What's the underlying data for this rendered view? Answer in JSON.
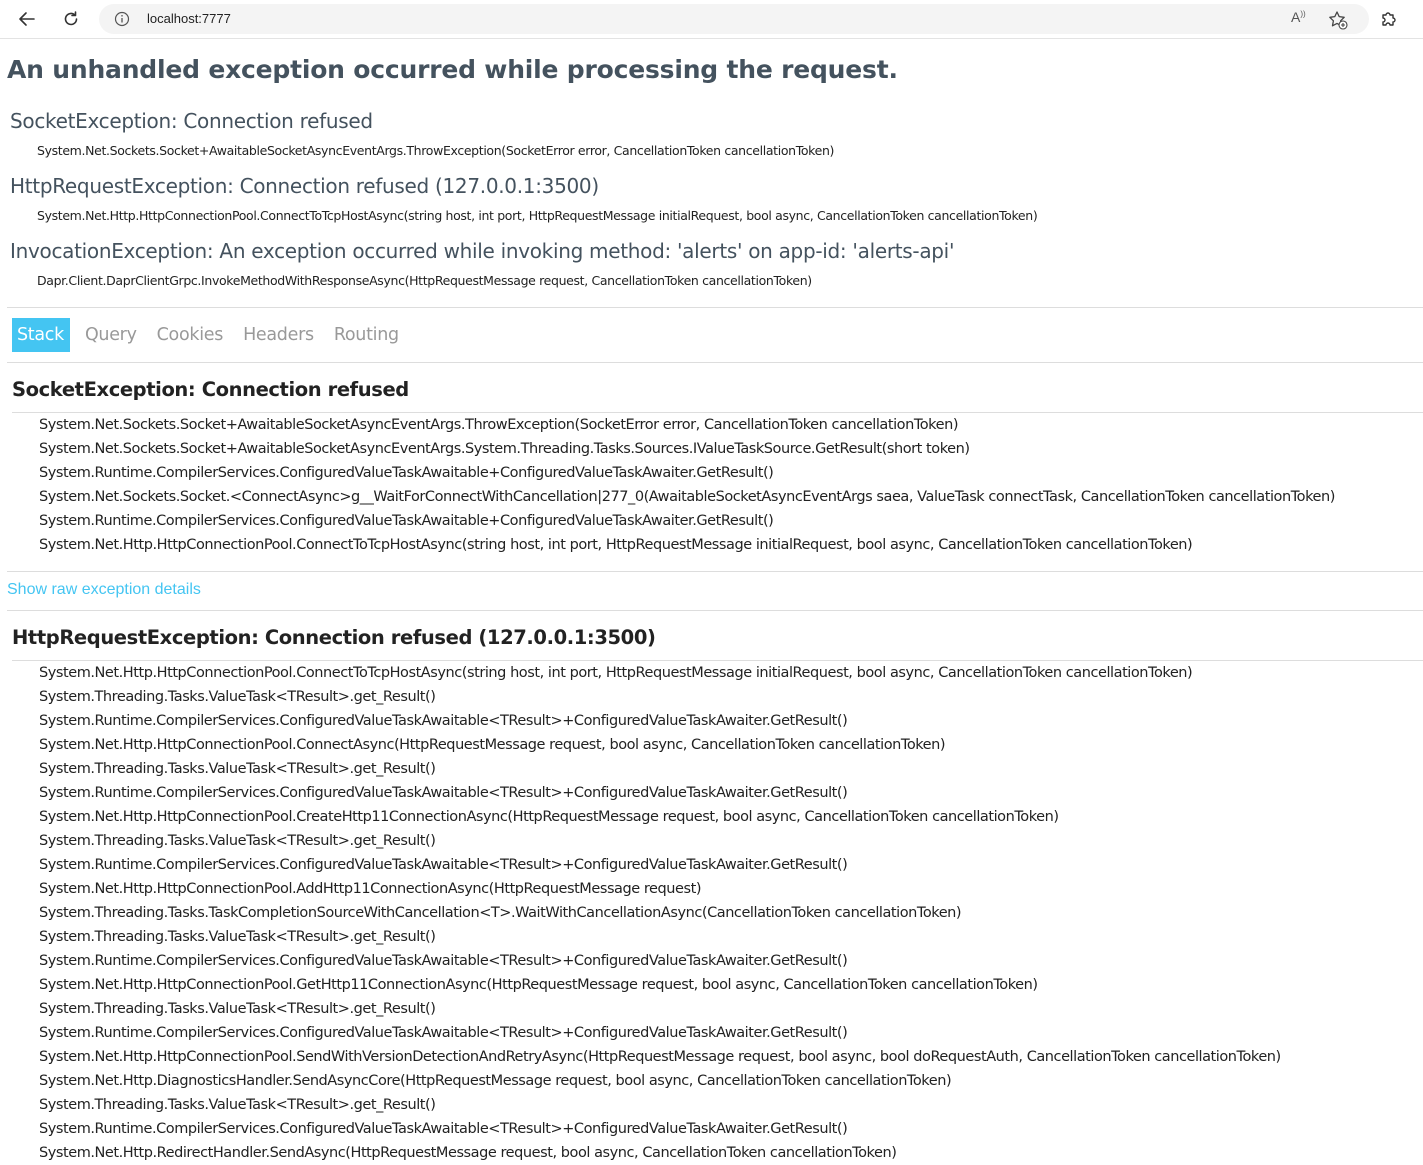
{
  "browser": {
    "url": "localhost:7777",
    "read_aloud_label": "A"
  },
  "page": {
    "title": "An unhandled exception occurred while processing the request.",
    "summary": [
      {
        "title": "SocketException: Connection refused",
        "location": "System.Net.Sockets.Socket+AwaitableSocketAsyncEventArgs.ThrowException(SocketError error, CancellationToken cancellationToken)"
      },
      {
        "title": "HttpRequestException: Connection refused (127.0.0.1:3500)",
        "location": "System.Net.Http.HttpConnectionPool.ConnectToTcpHostAsync(string host, int port, HttpRequestMessage initialRequest, bool async, CancellationToken cancellationToken)"
      },
      {
        "title": "InvocationException: An exception occurred while invoking method: 'alerts' on app-id: 'alerts-api'",
        "location": "Dapr.Client.DaprClientGrpc.InvokeMethodWithResponseAsync(HttpRequestMessage request, CancellationToken cancellationToken)"
      }
    ],
    "tabs": [
      "Stack",
      "Query",
      "Cookies",
      "Headers",
      "Routing"
    ],
    "active_tab": "Stack",
    "raw_link": "Show raw exception details",
    "stack_sections": [
      {
        "title": "SocketException: Connection refused",
        "frames": [
          "System.Net.Sockets.Socket+AwaitableSocketAsyncEventArgs.ThrowException(SocketError error, CancellationToken cancellationToken)",
          "System.Net.Sockets.Socket+AwaitableSocketAsyncEventArgs.System.Threading.Tasks.Sources.IValueTaskSource.GetResult(short token)",
          "System.Runtime.CompilerServices.ConfiguredValueTaskAwaitable+ConfiguredValueTaskAwaiter.GetResult()",
          "System.Net.Sockets.Socket.<ConnectAsync>g__WaitForConnectWithCancellation|277_0(AwaitableSocketAsyncEventArgs saea, ValueTask connectTask, CancellationToken cancellationToken)",
          "System.Runtime.CompilerServices.ConfiguredValueTaskAwaitable+ConfiguredValueTaskAwaiter.GetResult()",
          "System.Net.Http.HttpConnectionPool.ConnectToTcpHostAsync(string host, int port, HttpRequestMessage initialRequest, bool async, CancellationToken cancellationToken)"
        ]
      },
      {
        "title": "HttpRequestException: Connection refused (127.0.0.1:3500)",
        "frames": [
          "System.Net.Http.HttpConnectionPool.ConnectToTcpHostAsync(string host, int port, HttpRequestMessage initialRequest, bool async, CancellationToken cancellationToken)",
          "System.Threading.Tasks.ValueTask<TResult>.get_Result()",
          "System.Runtime.CompilerServices.ConfiguredValueTaskAwaitable<TResult>+ConfiguredValueTaskAwaiter.GetResult()",
          "System.Net.Http.HttpConnectionPool.ConnectAsync(HttpRequestMessage request, bool async, CancellationToken cancellationToken)",
          "System.Threading.Tasks.ValueTask<TResult>.get_Result()",
          "System.Runtime.CompilerServices.ConfiguredValueTaskAwaitable<TResult>+ConfiguredValueTaskAwaiter.GetResult()",
          "System.Net.Http.HttpConnectionPool.CreateHttp11ConnectionAsync(HttpRequestMessage request, bool async, CancellationToken cancellationToken)",
          "System.Threading.Tasks.ValueTask<TResult>.get_Result()",
          "System.Runtime.CompilerServices.ConfiguredValueTaskAwaitable<TResult>+ConfiguredValueTaskAwaiter.GetResult()",
          "System.Net.Http.HttpConnectionPool.AddHttp11ConnectionAsync(HttpRequestMessage request)",
          "System.Threading.Tasks.TaskCompletionSourceWithCancellation<T>.WaitWithCancellationAsync(CancellationToken cancellationToken)",
          "System.Threading.Tasks.ValueTask<TResult>.get_Result()",
          "System.Runtime.CompilerServices.ConfiguredValueTaskAwaitable<TResult>+ConfiguredValueTaskAwaiter.GetResult()",
          "System.Net.Http.HttpConnectionPool.GetHttp11ConnectionAsync(HttpRequestMessage request, bool async, CancellationToken cancellationToken)",
          "System.Threading.Tasks.ValueTask<TResult>.get_Result()",
          "System.Runtime.CompilerServices.ConfiguredValueTaskAwaitable<TResult>+ConfiguredValueTaskAwaiter.GetResult()",
          "System.Net.Http.HttpConnectionPool.SendWithVersionDetectionAndRetryAsync(HttpRequestMessage request, bool async, bool doRequestAuth, CancellationToken cancellationToken)",
          "System.Net.Http.DiagnosticsHandler.SendAsyncCore(HttpRequestMessage request, bool async, CancellationToken cancellationToken)",
          "System.Threading.Tasks.ValueTask<TResult>.get_Result()",
          "System.Runtime.CompilerServices.ConfiguredValueTaskAwaitable<TResult>+ConfiguredValueTaskAwaiter.GetResult()",
          "System.Net.Http.RedirectHandler.SendAsync(HttpRequestMessage request, bool async, CancellationToken cancellationToken)"
        ]
      }
    ]
  },
  "colors": {
    "accent": "#44c5f2",
    "heading": "#44525e",
    "divider": "#dddddd"
  }
}
